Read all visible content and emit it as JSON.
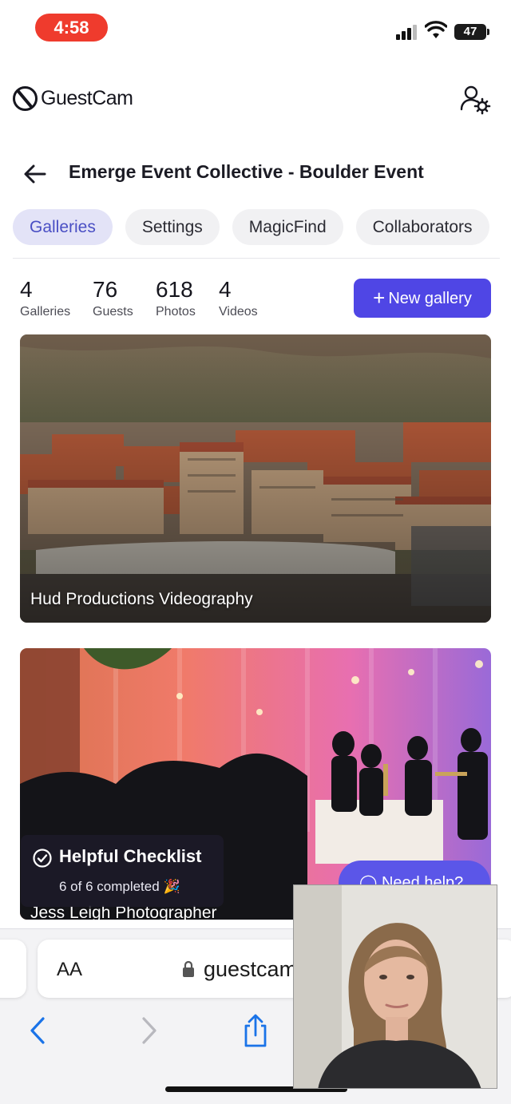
{
  "status_bar": {
    "time": "4:58",
    "battery": "47"
  },
  "header": {
    "logo_text": "GuestCam",
    "user_settings_icon": "user-gear-icon"
  },
  "event": {
    "title": "Emerge Event Collective - Boulder Event",
    "back_icon": "arrow-left-icon"
  },
  "tabs": [
    {
      "label": "Galleries",
      "active": true
    },
    {
      "label": "Settings",
      "active": false
    },
    {
      "label": "MagicFind",
      "active": false
    },
    {
      "label": "Collaborators",
      "active": false
    }
  ],
  "stats": [
    {
      "value": "4",
      "label": "Galleries"
    },
    {
      "value": "76",
      "label": "Guests"
    },
    {
      "value": "618",
      "label": "Photos"
    },
    {
      "value": "4",
      "label": "Videos"
    }
  ],
  "new_gallery": {
    "plus": "+",
    "label": "New gallery"
  },
  "galleries": [
    {
      "name": "Hud Productions Videography",
      "image": "aerial view of red-roofed campus buildings and stadium below forested hills"
    },
    {
      "name": "Jess Leigh Photographer",
      "image": "band playing on stage with colorful curtain lighting and dancing guests"
    }
  ],
  "checklist": {
    "title": "Helpful Checklist",
    "progress": "6 of 6 completed",
    "emoji": "🎉"
  },
  "help_button": {
    "label": "Need help?"
  },
  "browser": {
    "text_size": "AA",
    "url": "guestcam"
  },
  "colors": {
    "accent": "#4f46e5",
    "active_tab_bg": "#e3e3f7",
    "active_tab_text": "#4a4fc4",
    "time_pill": "#ef3b2d"
  }
}
